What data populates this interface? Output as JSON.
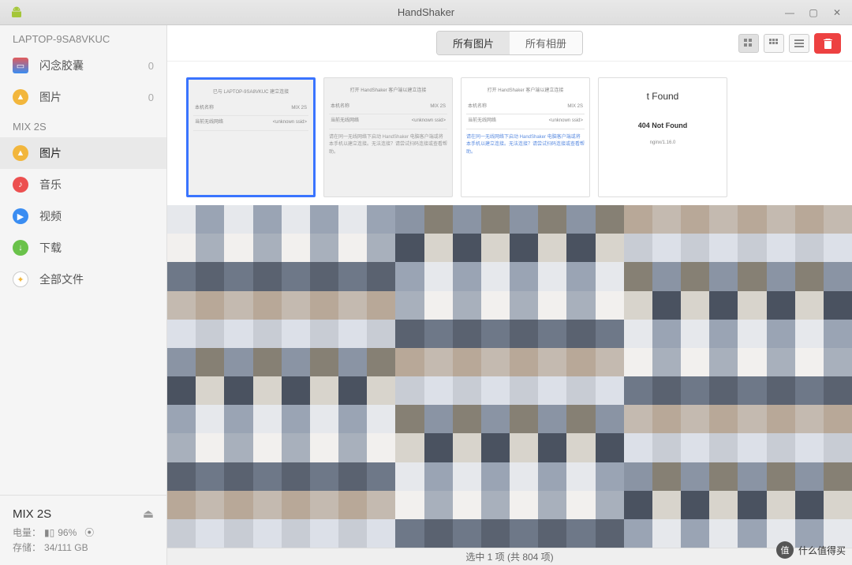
{
  "window": {
    "title": "HandShaker"
  },
  "sidebar": {
    "group1_hdr": "LAPTOP-9SA8VKUC",
    "group2_hdr": "MIX 2S",
    "items_pc": [
      {
        "label": "闪念胶囊",
        "count": "0",
        "color": "#e25b5b"
      },
      {
        "label": "图片",
        "count": "0",
        "color": "#f2b63c"
      }
    ],
    "items_phone": [
      {
        "label": "图片",
        "color": "#f2b63c"
      },
      {
        "label": "音乐",
        "color": "#ec5050"
      },
      {
        "label": "视频",
        "color": "#3a8df2"
      },
      {
        "label": "下载",
        "color": "#6ac24a"
      },
      {
        "label": "全部文件",
        "color": "#aaaaaa"
      }
    ],
    "footer": {
      "device": "MIX 2S",
      "battery_label": "电量：",
      "battery_pct": "96%",
      "storage_label": "存储：",
      "storage_val": "34/111 GB"
    }
  },
  "toolbar": {
    "seg": {
      "all_photos": "所有图片",
      "all_albums": "所有相册"
    }
  },
  "thumbs": {
    "t1": {
      "line1": "已与 LAPTOP-9SA8VKUC 建立连接",
      "row1a": "本机名称",
      "row1b": "MIX 2S",
      "row2a": "当前无线网络",
      "row2b": "<unknown ssid>"
    },
    "t2": {
      "line1": "打开 HandShaker 客户端以建立连接",
      "row1a": "本机名称",
      "row1b": "MIX 2S",
      "row2a": "当前无线网络",
      "row2b": "<unknown ssid>",
      "hint": "请在同一无线网络下启动 HandShaker 电脑客户端或将本手机以建立连接。无法连接？请尝试扫码连接或查看帮助。"
    },
    "t3": {
      "line1": "打开 HandShaker 客户端以建立连接",
      "row1a": "本机名称",
      "row1b": "MIX 2S",
      "row2a": "当前无线网络",
      "row2b": "<unknown ssid>",
      "hint": "请在同一无线网络下启动 HandShaker 电脑客户端或将本手机以建立连接。无法连接？请尝试扫码连接或查看帮助。"
    },
    "t4": {
      "big": "t Found",
      "mid": "404 Not Found",
      "sm": "nginx/1.16.0"
    }
  },
  "statusbar": {
    "text": "选中 1 项 (共 804 项)"
  },
  "watermark": {
    "text": "什么值得买",
    "badge": "值"
  }
}
